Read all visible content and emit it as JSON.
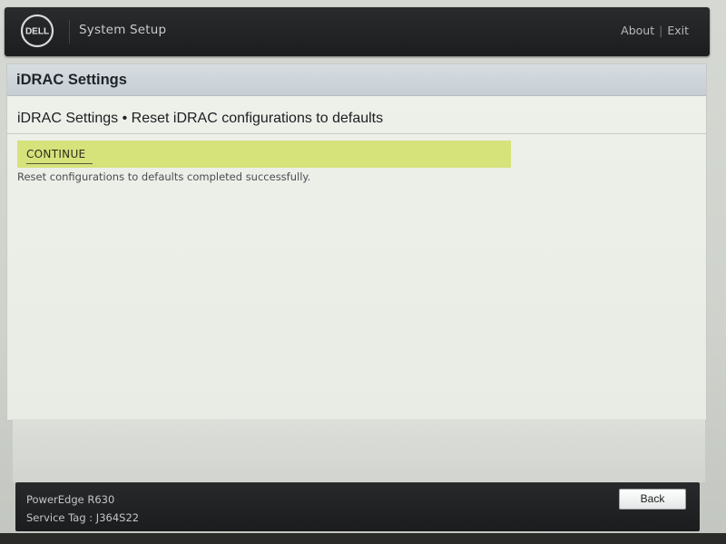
{
  "header": {
    "brand": "DELL",
    "app_title": "System Setup",
    "links": {
      "about": "About",
      "separator": "|",
      "exit": "Exit"
    }
  },
  "panel": {
    "title": "iDRAC Settings",
    "section_title": "iDRAC Settings • Reset iDRAC configurations to defaults",
    "continue_label": "CONTINUE",
    "status_message": "Reset configurations to defaults completed successfully."
  },
  "footer": {
    "model": "PowerEdge R630",
    "service_tag": "Service Tag : J364S22",
    "back_label": "Back"
  },
  "colors": {
    "highlight": "#d6e27a",
    "header_bar": "#1c1d1f",
    "panel_header": "#c6ced4"
  }
}
